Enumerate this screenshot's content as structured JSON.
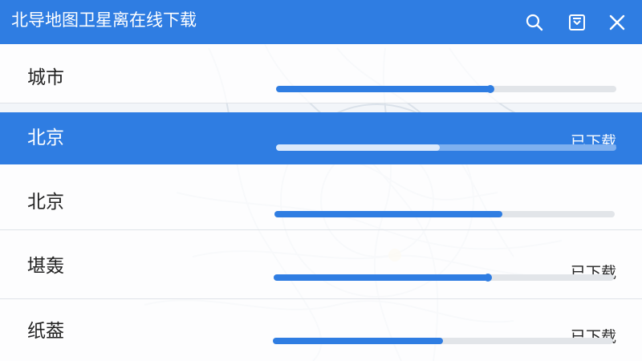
{
  "header": {
    "title": "北导地图卫星离在线下载",
    "icons": [
      "search-icon",
      "download-box-icon",
      "close-icon"
    ],
    "accent": "#2f7de2"
  },
  "list": {
    "column_label": "城市",
    "column_progress": 0.63,
    "rows": [
      {
        "name": "北京",
        "status": "已下载",
        "progress": 0.48,
        "selected": true
      },
      {
        "name": "北京",
        "status": "",
        "progress": 0.67,
        "selected": false
      },
      {
        "name": "堪轰",
        "status": "已下载",
        "progress": 0.63,
        "selected": false
      },
      {
        "name": "纸葢",
        "status": "已下载",
        "progress": 0.5,
        "selected": false
      }
    ]
  }
}
